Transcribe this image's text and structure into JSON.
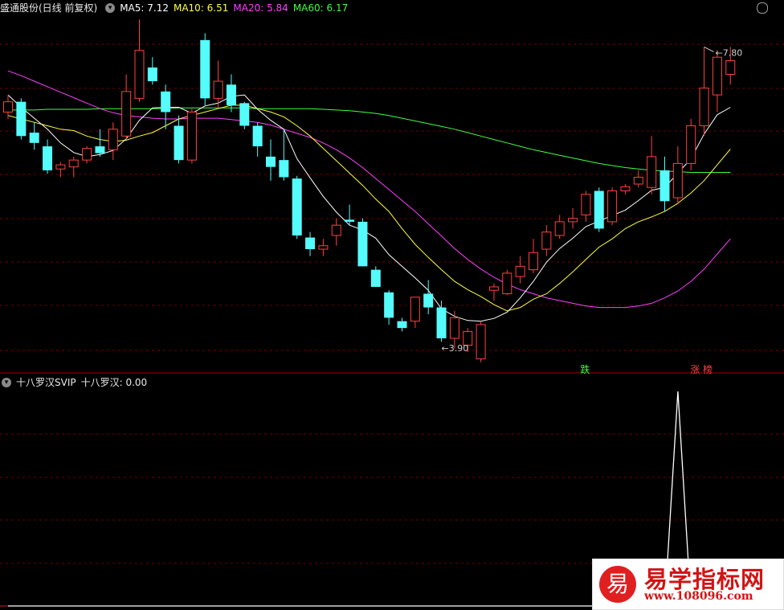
{
  "main": {
    "title": "盛通股份(日线 前复权)",
    "ma5": {
      "label": "MA5: 7.12",
      "color": "#ffffff"
    },
    "ma10": {
      "label": "MA10: 6.51",
      "color": "#ffff40"
    },
    "ma20": {
      "label": "MA20: 5.84",
      "color": "#ff40ff"
    },
    "ma60": {
      "label": "MA60: 6.17",
      "color": "#40ff40"
    },
    "high_label": "7.80",
    "low_label": "3.90",
    "events": [
      {
        "text": "跌",
        "color": "#40ff40"
      },
      {
        "text": "涨 榜",
        "color": "#ff4040"
      }
    ]
  },
  "indicator": {
    "name": "十八罗汉SVIP",
    "value_label": "十八罗汉: 0.00"
  },
  "colors": {
    "up": "#ff4040",
    "down": "#54fcfc",
    "grid": "#6e0000"
  },
  "watermark": {
    "logo": "易",
    "title": "易学指标网",
    "url": "www.108096.com"
  },
  "candles": [
    [
      7.05,
      7.3,
      6.95,
      7.2
    ],
    [
      7.2,
      7.25,
      6.65,
      6.7
    ],
    [
      6.75,
      6.9,
      6.5,
      6.6
    ],
    [
      6.55,
      6.65,
      6.15,
      6.2
    ],
    [
      6.22,
      6.32,
      6.1,
      6.28
    ],
    [
      6.25,
      6.4,
      6.1,
      6.35
    ],
    [
      6.35,
      6.55,
      6.3,
      6.52
    ],
    [
      6.55,
      6.8,
      6.4,
      6.45
    ],
    [
      6.5,
      6.9,
      6.35,
      6.8
    ],
    [
      6.7,
      7.6,
      6.65,
      7.35
    ],
    [
      7.25,
      8.4,
      7.2,
      7.95
    ],
    [
      7.7,
      7.85,
      7.45,
      7.5
    ],
    [
      7.35,
      7.45,
      6.8,
      7.05
    ],
    [
      6.85,
      7.0,
      6.3,
      6.35
    ],
    [
      6.35,
      7.1,
      6.3,
      7.05
    ],
    [
      8.1,
      8.2,
      7.15,
      7.25
    ],
    [
      7.25,
      7.8,
      7.1,
      7.5
    ],
    [
      7.45,
      7.6,
      7.05,
      7.15
    ],
    [
      7.18,
      7.2,
      6.8,
      6.85
    ],
    [
      6.85,
      6.9,
      6.4,
      6.55
    ],
    [
      6.4,
      6.65,
      6.05,
      6.25
    ],
    [
      6.35,
      6.8,
      6.05,
      6.1
    ],
    [
      6.08,
      6.12,
      5.2,
      5.25
    ],
    [
      5.22,
      5.3,
      4.95,
      5.05
    ],
    [
      5.05,
      5.2,
      4.95,
      5.1
    ],
    [
      5.25,
      5.5,
      5.1,
      5.4
    ],
    [
      5.48,
      5.7,
      5.4,
      5.45
    ],
    [
      5.45,
      5.5,
      4.8,
      4.8
    ],
    [
      4.75,
      4.8,
      4.5,
      4.5
    ],
    [
      4.42,
      4.45,
      3.95,
      4.05
    ],
    [
      4.0,
      4.05,
      3.85,
      3.9
    ],
    [
      4.0,
      4.3,
      3.9,
      4.35
    ],
    [
      4.4,
      4.6,
      4.1,
      4.2
    ],
    [
      4.2,
      4.3,
      3.7,
      3.75
    ],
    [
      3.75,
      4.15,
      3.6,
      4.05
    ],
    [
      3.65,
      3.9,
      3.55,
      3.85
    ],
    [
      3.45,
      4.0,
      3.4,
      3.95
    ],
    [
      4.45,
      4.55,
      4.3,
      4.5
    ],
    [
      4.4,
      4.75,
      4.38,
      4.7
    ],
    [
      4.65,
      4.95,
      4.55,
      4.8
    ],
    [
      4.75,
      5.2,
      4.7,
      5.0
    ],
    [
      5.05,
      5.4,
      4.95,
      5.3
    ],
    [
      5.25,
      5.55,
      5.2,
      5.45
    ],
    [
      5.45,
      5.65,
      5.35,
      5.5
    ],
    [
      5.55,
      5.9,
      5.45,
      5.85
    ],
    [
      5.9,
      5.95,
      5.3,
      5.35
    ],
    [
      5.45,
      5.95,
      5.4,
      5.9
    ],
    [
      5.9,
      6.0,
      5.85,
      5.96
    ],
    [
      6.0,
      6.2,
      5.95,
      6.1
    ],
    [
      5.95,
      6.7,
      5.85,
      6.4
    ],
    [
      6.2,
      6.4,
      5.6,
      5.75
    ],
    [
      5.8,
      6.55,
      5.7,
      6.3
    ],
    [
      6.3,
      6.95,
      6.2,
      6.85
    ],
    [
      6.85,
      8.0,
      6.7,
      7.4
    ],
    [
      7.3,
      7.95,
      7.05,
      7.85
    ],
    [
      7.6,
      8.0,
      7.45,
      7.8
    ]
  ],
  "ma5_series": [
    7.3,
    7.12,
    6.96,
    6.8,
    6.6,
    6.46,
    6.4,
    6.43,
    6.49,
    6.66,
    6.93,
    7.11,
    7.12,
    7.12,
    7.03,
    7.14,
    7.18,
    7.28,
    7.3,
    7.09,
    6.93,
    6.8,
    6.37,
    6.09,
    5.82,
    5.59,
    5.4,
    5.33,
    5.21,
    4.97,
    4.8,
    4.63,
    4.45,
    4.18,
    4.07,
    4.01,
    4.0,
    4.04,
    4.13,
    4.34,
    4.58,
    4.86,
    5.06,
    5.21,
    5.38,
    5.46,
    5.54,
    5.62,
    5.76,
    5.91,
    5.95,
    6.16,
    6.37,
    6.73,
    7.01,
    7.12
  ],
  "ma10_series": [
    7.0,
    6.95,
    6.9,
    6.85,
    6.8,
    6.78,
    6.7,
    6.65,
    6.62,
    6.64,
    6.7,
    6.75,
    6.85,
    6.95,
    7.0,
    7.05,
    7.1,
    7.15,
    7.15,
    7.1,
    7.05,
    6.98,
    6.85,
    6.7,
    6.52,
    6.34,
    6.16,
    5.98,
    5.78,
    5.6,
    5.35,
    5.12,
    4.93,
    4.75,
    4.58,
    4.46,
    4.36,
    4.24,
    4.15,
    4.2,
    4.32,
    4.4,
    4.55,
    4.72,
    4.9,
    5.08,
    5.2,
    5.35,
    5.45,
    5.52,
    5.6,
    5.72,
    5.87,
    6.05,
    6.28,
    6.51
  ],
  "ma20_series": [
    7.65,
    7.58,
    7.5,
    7.42,
    7.34,
    7.26,
    7.18,
    7.1,
    7.04,
    7.0,
    6.98,
    6.96,
    6.95,
    6.95,
    6.96,
    6.96,
    6.96,
    6.94,
    6.92,
    6.9,
    6.86,
    6.8,
    6.74,
    6.68,
    6.6,
    6.5,
    6.38,
    6.24,
    6.08,
    5.92,
    5.76,
    5.6,
    5.42,
    5.24,
    5.06,
    4.9,
    4.76,
    4.64,
    4.54,
    4.46,
    4.4,
    4.34,
    4.3,
    4.26,
    4.22,
    4.2,
    4.2,
    4.2,
    4.22,
    4.26,
    4.34,
    4.44,
    4.58,
    4.76,
    4.98,
    5.2
  ],
  "ma60_series": [
    7.08,
    7.08,
    7.08,
    7.09,
    7.09,
    7.09,
    7.09,
    7.1,
    7.1,
    7.1,
    7.1,
    7.1,
    7.1,
    7.11,
    7.11,
    7.11,
    7.11,
    7.11,
    7.11,
    7.1,
    7.1,
    7.1,
    7.1,
    7.1,
    7.09,
    7.08,
    7.07,
    7.05,
    7.03,
    7.0,
    6.96,
    6.92,
    6.88,
    6.84,
    6.8,
    6.75,
    6.7,
    6.65,
    6.6,
    6.55,
    6.5,
    6.46,
    6.42,
    6.38,
    6.34,
    6.3,
    6.27,
    6.24,
    6.22,
    6.2,
    6.19,
    6.18,
    6.17,
    6.17,
    6.17,
    6.17
  ],
  "indicator_series": [
    0,
    0,
    0,
    0,
    0,
    0,
    0,
    0,
    0,
    0,
    0,
    0,
    0,
    0,
    0,
    0,
    0,
    0,
    0,
    0,
    0,
    0,
    0,
    0,
    0,
    0,
    0,
    0,
    0,
    0,
    0,
    0,
    0,
    0,
    0,
    0,
    0,
    0,
    0,
    0,
    0,
    0,
    0,
    0,
    0,
    0,
    0,
    0,
    0,
    0,
    0,
    1,
    0,
    0,
    0,
    0
  ]
}
